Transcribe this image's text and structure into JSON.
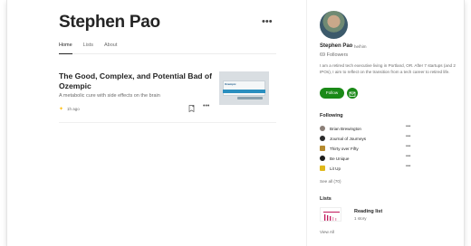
{
  "author": {
    "name": "Stephen Pao"
  },
  "tabs": [
    "Home",
    "Lists",
    "About"
  ],
  "post": {
    "title": "The Good, Complex, and Potential Bad of Ozempic",
    "subtitle": "A metabolic cure with side effects on the brain",
    "time": "1h ago",
    "thumbnail_label": "Ozempic"
  },
  "sidebar": {
    "name": "Stephen Pao",
    "pronouns": "he/him",
    "followers": "69 Followers",
    "bio": "I am a retired tech executive living in Portland, OR. After 7 startups (and 2 IPOs), I aim to reflect on the transition from a tech career to retired life.",
    "follow_label": "Follow",
    "following_heading": "Following",
    "following": [
      {
        "name": "Brian Brewington",
        "color": "#8b7f78"
      },
      {
        "name": "Journal of Journeys",
        "color": "#2b2b2b"
      },
      {
        "name": "Thirty over Fifty",
        "color": "#b58a2e"
      },
      {
        "name": "Be Unique",
        "color": "#1c1c1c"
      },
      {
        "name": "Lit Up",
        "color": "#e0b81a"
      }
    ],
    "see_all": "See all (70)",
    "lists_heading": "Lists",
    "list": {
      "name": "Reading list",
      "count": "1 story"
    },
    "view_all": "View All"
  },
  "colors": {
    "accent": "#1a8917",
    "star": "#ffc017",
    "list_pink": "#c2185b"
  }
}
